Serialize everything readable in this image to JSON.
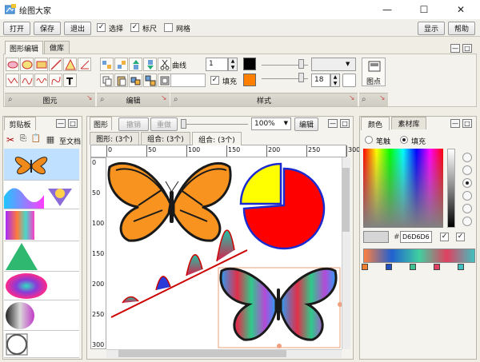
{
  "app": {
    "title": "绘图大家"
  },
  "window": {
    "minimize": "—",
    "maximize": "☐",
    "close": "✕"
  },
  "menubar": {
    "open": "打开",
    "save": "保存",
    "exit": "退出",
    "select": "选择",
    "ruler": "标尺",
    "grid": "网格",
    "show": "显示",
    "help": "帮助",
    "select_checked": true,
    "ruler_checked": true,
    "grid_checked": false
  },
  "ribbon": {
    "tabs": [
      "图形编辑",
      "做库"
    ],
    "groups": {
      "elements": "图元",
      "edit": "编辑",
      "style": "样式"
    },
    "style": {
      "line_label": "曲线",
      "line_width": "1",
      "fill_label": "填充",
      "fill_checked": true,
      "font_size": "18",
      "line_color": "#000000",
      "fill_color": "#ff8000"
    },
    "points_label": "图点"
  },
  "clipboard": {
    "tab": "剪贴板",
    "to_doc": "至文档"
  },
  "canvas": {
    "tab": "图形",
    "undo": "撤销",
    "redo": "重做",
    "zoom": "100%",
    "edit": "编辑",
    "sub_tabs": [
      "图形: (3个)",
      "组合: (3个)",
      "组合: (3个)"
    ],
    "ruler_x": [
      "0",
      "50",
      "100",
      "150",
      "200",
      "250",
      "300"
    ],
    "ruler_y": [
      "0",
      "50",
      "100",
      "150",
      "200",
      "250",
      "300"
    ]
  },
  "color_panel": {
    "tabs": [
      "颜色",
      "素材库"
    ],
    "stroke": "笔触",
    "fill": "填充",
    "stroke_selected": false,
    "fill_selected": true,
    "hex": "D6D6D6"
  }
}
